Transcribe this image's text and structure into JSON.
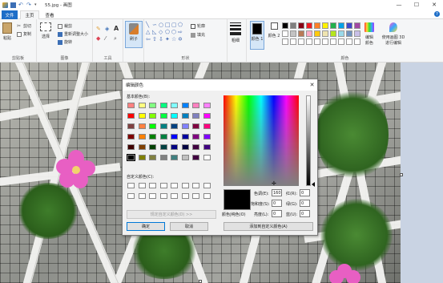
{
  "window": {
    "title": "55.jpg - 画图",
    "controls": [
      "—",
      "☐",
      "✕"
    ]
  },
  "tabs": {
    "file": "文件",
    "home": "主页",
    "view": "查看"
  },
  "ribbon": {
    "clipboard": {
      "paste": "粘贴",
      "cut": "剪切",
      "copy": "复制",
      "group": "剪贴板"
    },
    "image": {
      "select": "选择",
      "crop": "裁剪",
      "resize": "重新调整大小",
      "rotate": "旋转",
      "group": "图像"
    },
    "tools": {
      "group": "工具"
    },
    "brushes": {
      "label": "刷子"
    },
    "shapes": {
      "outline": "轮廓",
      "fill": "填充",
      "group": "形状"
    },
    "size": {
      "label": "粗细"
    },
    "colors": {
      "color1": "颜色 1",
      "color2": "颜色 2",
      "edit": "编辑颜色",
      "paint3d": "使用画图 3D 进行编辑",
      "group": "颜色"
    },
    "palette": [
      "#000000",
      "#7f7f7f",
      "#880015",
      "#ed1c24",
      "#ff7f27",
      "#fff200",
      "#22b14c",
      "#00a2e8",
      "#3f48cc",
      "#a349a4",
      "#ffffff",
      "#c3c3c3",
      "#b97a57",
      "#ffaec9",
      "#ffc90e",
      "#efe4b0",
      "#b5e61d",
      "#99d9ea",
      "#7092be",
      "#c8bfe7",
      "#ffffff",
      "#ffffff",
      "#ffffff",
      "#ffffff",
      "#ffffff",
      "#ffffff",
      "#ffffff",
      "#ffffff",
      "#ffffff",
      "#ffffff"
    ]
  },
  "dialog": {
    "title": "编辑颜色",
    "basic_colors_label": "基本颜色(B):",
    "custom_colors_label": "自定义颜色(C):",
    "define_custom_button": "规定自定义颜色(D) >>",
    "ok_button": "确定",
    "cancel_button": "取消",
    "add_custom_button": "添加到自定义颜色(A)",
    "color_solid_label": "颜色|纯色(O)",
    "fields": {
      "hue_label": "色调(E):",
      "hue_value": "160",
      "sat_label": "饱和度(S):",
      "sat_value": "0",
      "lum_label": "亮度(L):",
      "lum_value": "0",
      "red_label": "红(R):",
      "red_value": "0",
      "green_label": "绿(G):",
      "green_value": "0",
      "blue_label": "蓝(U):",
      "blue_value": "0"
    },
    "basic_colors": [
      "#ff8080",
      "#ffff80",
      "#80ff80",
      "#00ff80",
      "#80ffff",
      "#0080ff",
      "#ff80c0",
      "#ff80ff",
      "#ff0000",
      "#ffff00",
      "#80ff00",
      "#00ff40",
      "#00ffff",
      "#0080c0",
      "#8080c0",
      "#ff00ff",
      "#804040",
      "#ff8040",
      "#00ff00",
      "#008080",
      "#004080",
      "#8080ff",
      "#800040",
      "#ff0080",
      "#800000",
      "#ff8000",
      "#008000",
      "#008040",
      "#0000ff",
      "#0000a0",
      "#800080",
      "#8000ff",
      "#400000",
      "#804000",
      "#004000",
      "#004040",
      "#000080",
      "#000040",
      "#400040",
      "#400080",
      "#000000",
      "#808000",
      "#808040",
      "#808080",
      "#408080",
      "#c0c0c0",
      "#400040",
      "#ffffff"
    ]
  }
}
